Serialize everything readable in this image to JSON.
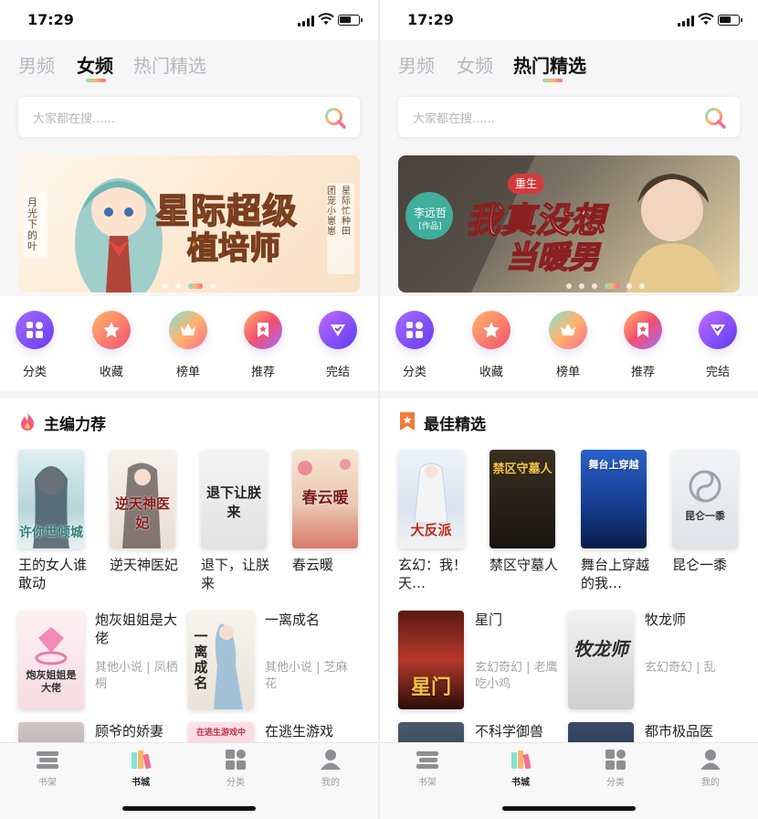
{
  "status": {
    "time": "17:29"
  },
  "left": {
    "tabs": [
      {
        "label": "男频"
      },
      {
        "label": "女频"
      },
      {
        "label": "热门精选"
      }
    ],
    "search_placeholder": "大家都在搜......",
    "banner": {
      "title_line1": "星际超级",
      "title_line2": "植培师",
      "side_left": "月光下的叶",
      "side_right1": "团宠小崽崽",
      "side_right2": "星际忙种田"
    },
    "categories": [
      {
        "label": "分类"
      },
      {
        "label": "收藏"
      },
      {
        "label": "榜单"
      },
      {
        "label": "推荐"
      },
      {
        "label": "完结"
      }
    ],
    "section_title": "主编力荐",
    "grid_books": [
      {
        "name": "王的女人谁敢动",
        "cover_text": "许你世倾城"
      },
      {
        "name": "逆天神医妃",
        "cover_text": "逆天神医妃"
      },
      {
        "name": "退下，让朕来",
        "cover_text": "退下让朕来"
      },
      {
        "name": "春云暖",
        "cover_text": "春云暖"
      }
    ],
    "list_books": [
      {
        "title": "炮灰姐姐是大佬",
        "meta": "其他小说 | 凤栖桐",
        "cover_text": "炮灰姐姐是大佬"
      },
      {
        "title": "一离成名",
        "meta": "其他小说 | 芝麻花",
        "cover_text": "一离成名"
      },
      {
        "title": "顾爷的娇妻",
        "meta": "",
        "cover_text": ""
      },
      {
        "title": "在逃生游戏",
        "meta": "",
        "cover_text": "在逃生游戏中"
      }
    ]
  },
  "right": {
    "tabs": [
      {
        "label": "男频"
      },
      {
        "label": "女频"
      },
      {
        "label": "热门精选"
      }
    ],
    "search_placeholder": "大家都在搜......",
    "banner": {
      "title_line1": "我真没想",
      "title_line2": "当暖男",
      "tag": "重生",
      "author": "李远哲",
      "author_sub": "[作品]"
    },
    "categories": [
      {
        "label": "分类"
      },
      {
        "label": "收藏"
      },
      {
        "label": "榜单"
      },
      {
        "label": "推荐"
      },
      {
        "label": "完结"
      }
    ],
    "section_title": "最佳精选",
    "grid_books": [
      {
        "name": "玄幻：我！天…",
        "cover_text": "大反派"
      },
      {
        "name": "禁区守墓人",
        "cover_text": "禁区守墓人"
      },
      {
        "name": "舞台上穿越的我…",
        "cover_text": "舞台上穿越"
      },
      {
        "name": "昆仑一黍",
        "cover_text": "昆仑一黍"
      }
    ],
    "list_books": [
      {
        "title": "星门",
        "meta": "玄幻奇幻 | 老鹰吃小鸡",
        "cover_text": "星门"
      },
      {
        "title": "牧龙师",
        "meta": "玄幻奇幻 | 乱",
        "cover_text": "牧龙师"
      },
      {
        "title": "不科学御兽",
        "meta": "",
        "cover_text": ""
      },
      {
        "title": "都市极品医",
        "meta": "",
        "cover_text": ""
      }
    ]
  },
  "tabbar": [
    {
      "label": "书架"
    },
    {
      "label": "书城"
    },
    {
      "label": "分类"
    },
    {
      "label": "我的"
    }
  ],
  "colors": {
    "accent_gradient": [
      "#7ee3d6",
      "#ffb36b",
      "#f56d8f"
    ],
    "inactive_tab": "#b8b8bc",
    "meta_text": "#a4a4a8"
  }
}
